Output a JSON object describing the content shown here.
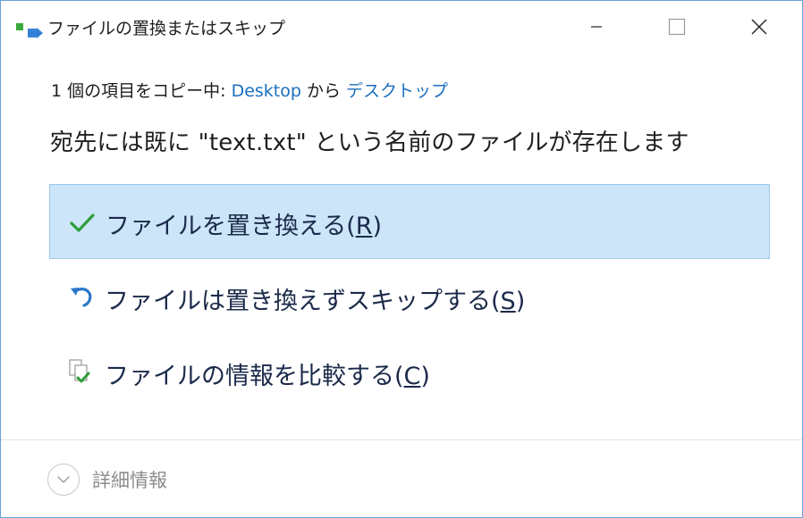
{
  "window": {
    "title": "ファイルの置換またはスキップ"
  },
  "progress": {
    "prefix": "1 個の項目をコピー中: ",
    "source": "Desktop",
    "middle": " から ",
    "destination": "デスクトップ"
  },
  "headline": "宛先には既に \"text.txt\" という名前のファイルが存在します",
  "options": [
    {
      "label": "ファイルを置き換える(",
      "key": "R",
      "suffix": ")",
      "icon": "checkmark-icon"
    },
    {
      "label": "ファイルは置き換えずスキップする(",
      "key": "S",
      "suffix": ")",
      "icon": "undo-arrow-icon"
    },
    {
      "label": "ファイルの情報を比較する(",
      "key": "C",
      "suffix": ")",
      "icon": "compare-files-icon"
    }
  ],
  "details": {
    "label": "詳細情報",
    "icon": "chevron-down-icon"
  },
  "colors": {
    "accent_link": "#1a6fbf",
    "selected_bg": "#cce5f8",
    "selected_border": "#9bc9ec",
    "check_green": "#2e9e3a",
    "undo_blue": "#2a78c8"
  }
}
